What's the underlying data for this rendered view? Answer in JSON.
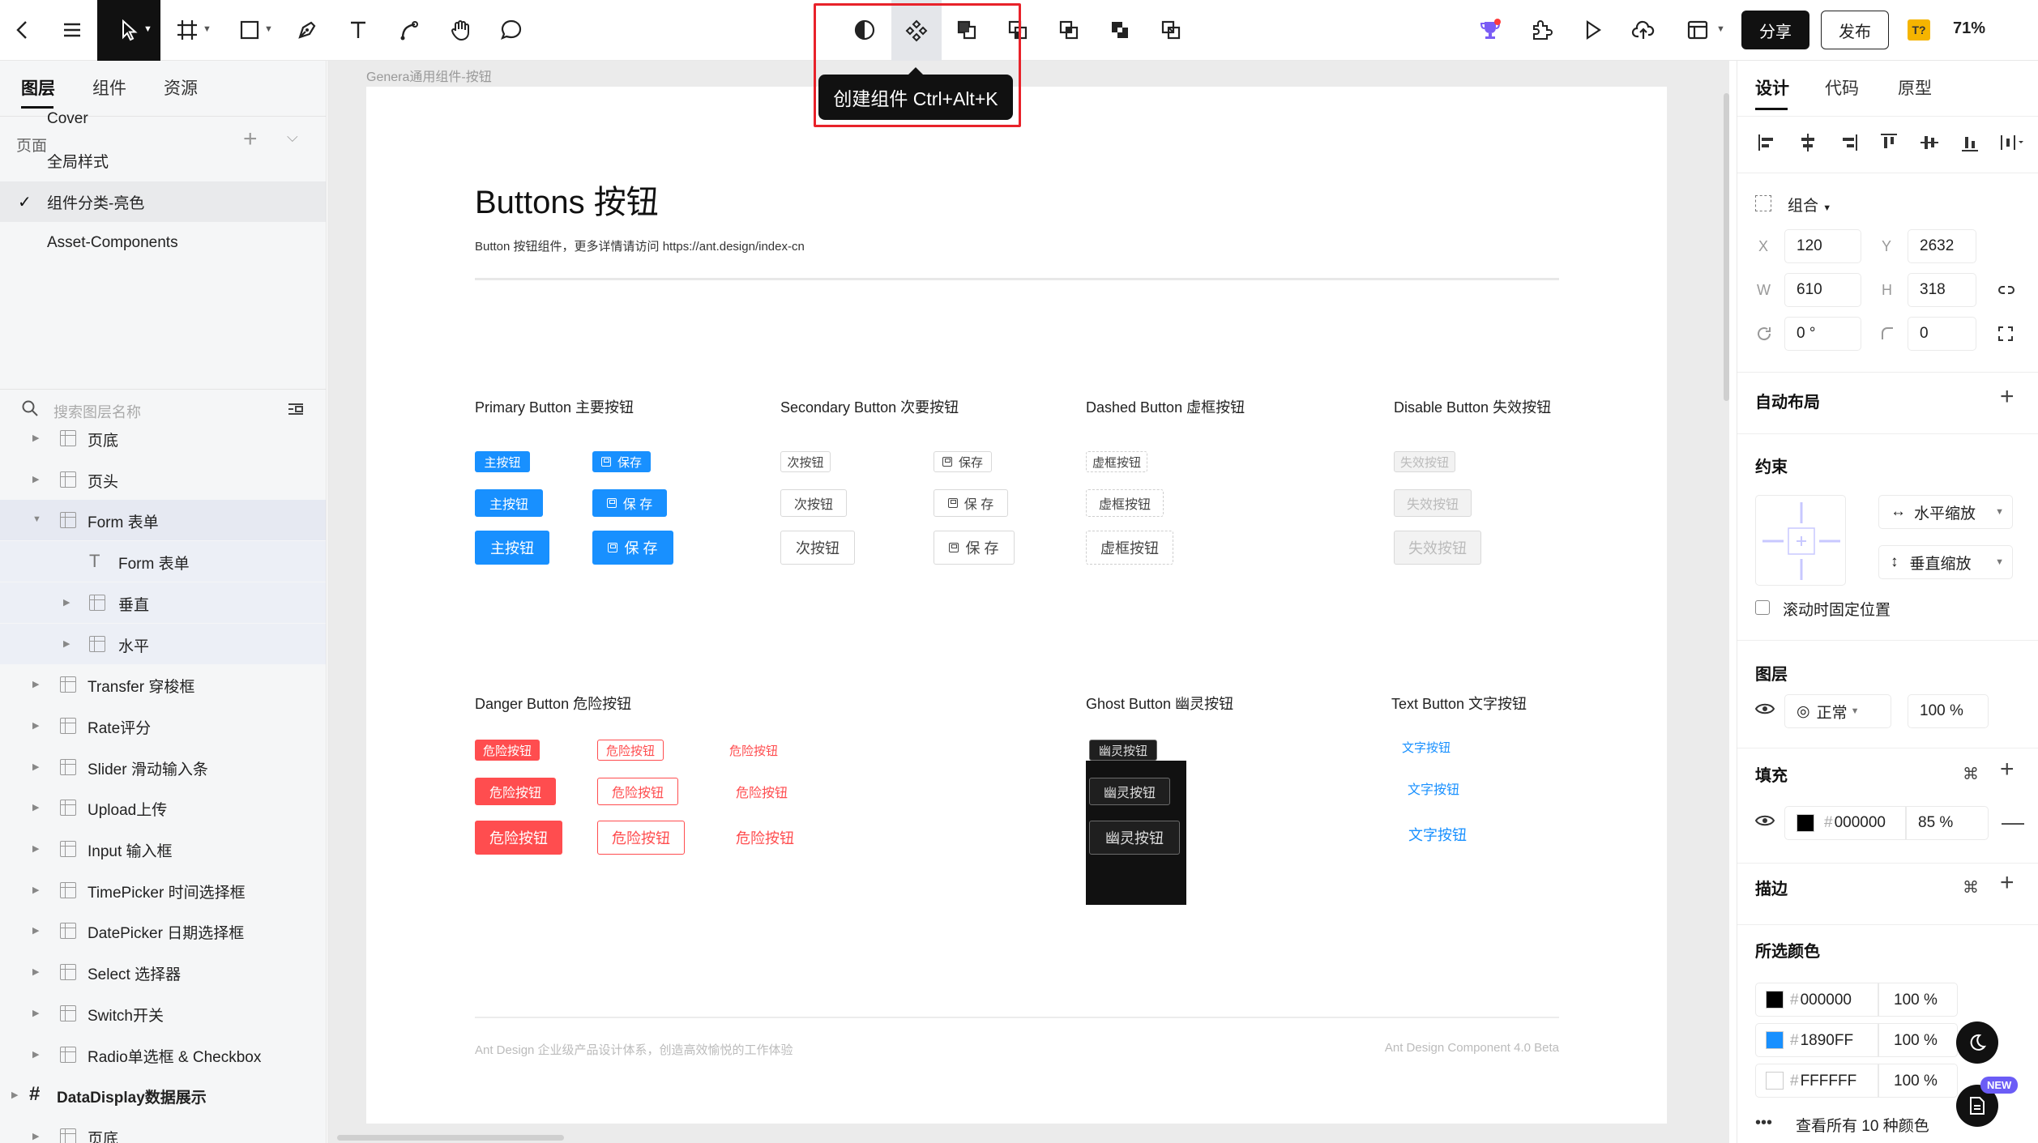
{
  "toolbar": {
    "share_label": "分享",
    "publish_label": "发布",
    "zoom": "71%",
    "font_badge": "T?"
  },
  "tooltip": {
    "text": "创建组件 Ctrl+Alt+K"
  },
  "left_panel": {
    "tabs": [
      "图层",
      "组件",
      "资源"
    ],
    "pages_label": "页面",
    "pages": [
      "Cover",
      "全局样式",
      "组件分类-亮色",
      "Asset-Components"
    ],
    "active_page_index": 2,
    "search_placeholder": "搜索图层名称",
    "layers": [
      {
        "name": "页底",
        "indent": 0,
        "kind": "frame"
      },
      {
        "name": "页头",
        "indent": 0,
        "kind": "frame"
      },
      {
        "name": "Form 表单",
        "indent": 0,
        "kind": "frame",
        "expanded": true,
        "selected": true
      },
      {
        "name": "Form 表单",
        "indent": 1,
        "kind": "text"
      },
      {
        "name": "垂直",
        "indent": 1,
        "kind": "frame"
      },
      {
        "name": "水平",
        "indent": 1,
        "kind": "frame"
      },
      {
        "name": "Transfer 穿梭框",
        "indent": 0,
        "kind": "frame"
      },
      {
        "name": "Rate评分",
        "indent": 0,
        "kind": "frame"
      },
      {
        "name": "Slider 滑动输入条",
        "indent": 0,
        "kind": "frame"
      },
      {
        "name": "Upload上传",
        "indent": 0,
        "kind": "frame"
      },
      {
        "name": "Input 输入框",
        "indent": 0,
        "kind": "frame"
      },
      {
        "name": "TimePicker 时间选择框",
        "indent": 0,
        "kind": "frame"
      },
      {
        "name": "DatePicker 日期选择框",
        "indent": 0,
        "kind": "frame"
      },
      {
        "name": "Select 选择器",
        "indent": 0,
        "kind": "frame"
      },
      {
        "name": "Switch开关",
        "indent": 0,
        "kind": "frame"
      },
      {
        "name": "Radio单选框 & Checkbox",
        "indent": 0,
        "kind": "frame"
      },
      {
        "name": "DataDisplay数据展示",
        "indent": -1,
        "kind": "board"
      },
      {
        "name": "页底",
        "indent": 0,
        "kind": "frame"
      }
    ]
  },
  "canvas": {
    "frame_label": "Genera通用组件-按钮",
    "title": "Buttons 按钮",
    "description": "Button 按钮组件，更多详情请访问 https://ant.design/index-cn",
    "groups": {
      "primary": "Primary Button 主要按钮",
      "secondary": "Secondary Button 次要按钮",
      "dashed": "Dashed Button 虚框按钮",
      "disable": "Disable Button 失效按钮",
      "danger": "Danger Button 危险按钮",
      "ghost": "Ghost Button 幽灵按钮",
      "text": "Text Button 文字按钮"
    },
    "labels": {
      "primary": "主按钮",
      "save_small": "保存",
      "save_spaced": "保 存",
      "secondary": "次按钮",
      "dashed": "虚框按钮",
      "disable": "失效按钮",
      "danger": "危险按钮",
      "ghost": "幽灵按钮",
      "text": "文字按钮"
    },
    "footer_left": "Ant Design 企业级产品设计体系，创造高效愉悦的工作体验",
    "footer_right": "Ant Design Component 4.0 Beta"
  },
  "right_panel": {
    "tabs": [
      "设计",
      "代码",
      "原型"
    ],
    "group_label": "组合",
    "x_label": "X",
    "x": "120",
    "y_label": "Y",
    "y": "2632",
    "w_label": "W",
    "w": "610",
    "h_label": "H",
    "h": "318",
    "rotation": "0 °",
    "radius": "0",
    "auto_layout": "自动布局",
    "constraints": "约束",
    "h_constraint": "水平缩放",
    "v_constraint": "垂直缩放",
    "fix_scroll": "滚动时固定位置",
    "layer_section": "图层",
    "blend": "正常",
    "layer_opacity": "100 %",
    "fill_section": "填充",
    "fill_hex": "000000",
    "fill_opacity": "85 %",
    "stroke_section": "描边",
    "selected_colors": "所选颜色",
    "colors": [
      {
        "hex": "000000",
        "opacity": "100 %",
        "swatch": "#000000"
      },
      {
        "hex": "1890FF",
        "opacity": "100 %",
        "swatch": "#1890FF"
      },
      {
        "hex": "FFFFFF",
        "opacity": "100 %",
        "swatch": "#FFFFFF"
      }
    ],
    "view_all_colors": "查看所有 10 种颜色",
    "new_badge": "NEW"
  }
}
